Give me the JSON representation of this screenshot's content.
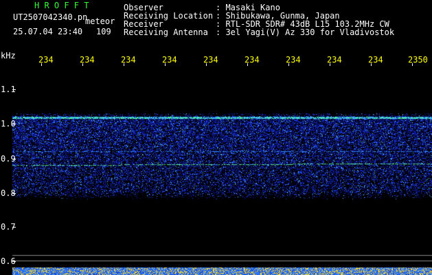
{
  "header": {
    "brand": "H R O F F T",
    "filename": "UT2507042340.pn",
    "type_label": "meteor",
    "datetime": "25.07.04 23:40",
    "count": "109"
  },
  "info": {
    "labels": [
      "Observer",
      "Receiving Location",
      "Receiver",
      "Receiving Antenna"
    ],
    "values": [
      ": Masaki Kano",
      ": Shibukawa, Gunma, Japan",
      ": RTL-SDR SDR# 43dB L15 103.2MHz CW",
      ": 3el Yagi(V) Az 330 for Vladivostok"
    ]
  },
  "axis": {
    "y_unit": "kHz",
    "y_ticks": [
      "1.1",
      "1.0",
      "0.9",
      "0.8",
      "0.7",
      "0.6"
    ],
    "x_ticks": [
      "234",
      "234",
      "234",
      "234",
      "234",
      "234",
      "234",
      "234",
      "234",
      "2350"
    ]
  },
  "colors": {
    "background": "#000000",
    "brand": "#33ff33",
    "tick_labels": "#ffff00",
    "text": "#ffffff",
    "noise_deep": "#0a14a0",
    "noise_mid": "#2040ff",
    "noise_bright": "#40c0ff",
    "signal_line": "#60ff80"
  }
}
